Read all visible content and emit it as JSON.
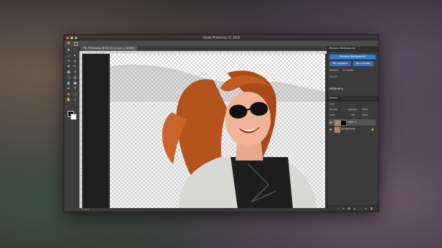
{
  "window": {
    "title": "Adobe Photoshop CC 2018"
  },
  "document": {
    "tab_label": "ML_Photoshop @ 53.1% (Layer 1, RGB/8)"
  },
  "status": {
    "zoom": "53.14%"
  },
  "tools": [
    "move-icon",
    "marquee-icon",
    "lasso-icon",
    "magic-wand-icon",
    "crop-icon",
    "eyedropper-icon",
    "heal-icon",
    "brush-icon",
    "stamp-icon",
    "history-brush-icon",
    "eraser-icon",
    "gradient-icon",
    "blur-icon",
    "dodge-icon",
    "pen-icon",
    "type-icon",
    "path-select-icon",
    "shape-icon",
    "hand-icon",
    "zoom-icon"
  ],
  "removebg": {
    "panel_title": "Remove Background",
    "primary_button": "Remove Background",
    "account_button": "My Account",
    "buy_button": "Buy Credits",
    "balance_label": "Balance:",
    "balance_value": "40 credits",
    "logout": "Log out",
    "logo_text": "remove",
    "logo_suffix": "bg",
    "colors": {
      "primary": "#2f7bd6",
      "secondary": "#3d6fb8"
    }
  },
  "layers": {
    "panel_title": "Layers",
    "kind_label": "Kind",
    "blend_mode": "Normal",
    "opacity_label": "Opacity:",
    "opacity_value": "100%",
    "lock_label": "Lock:",
    "fill_label": "Fill:",
    "fill_value": "100%",
    "items": [
      {
        "name": "Layer 1"
      },
      {
        "name": "Background"
      }
    ]
  }
}
